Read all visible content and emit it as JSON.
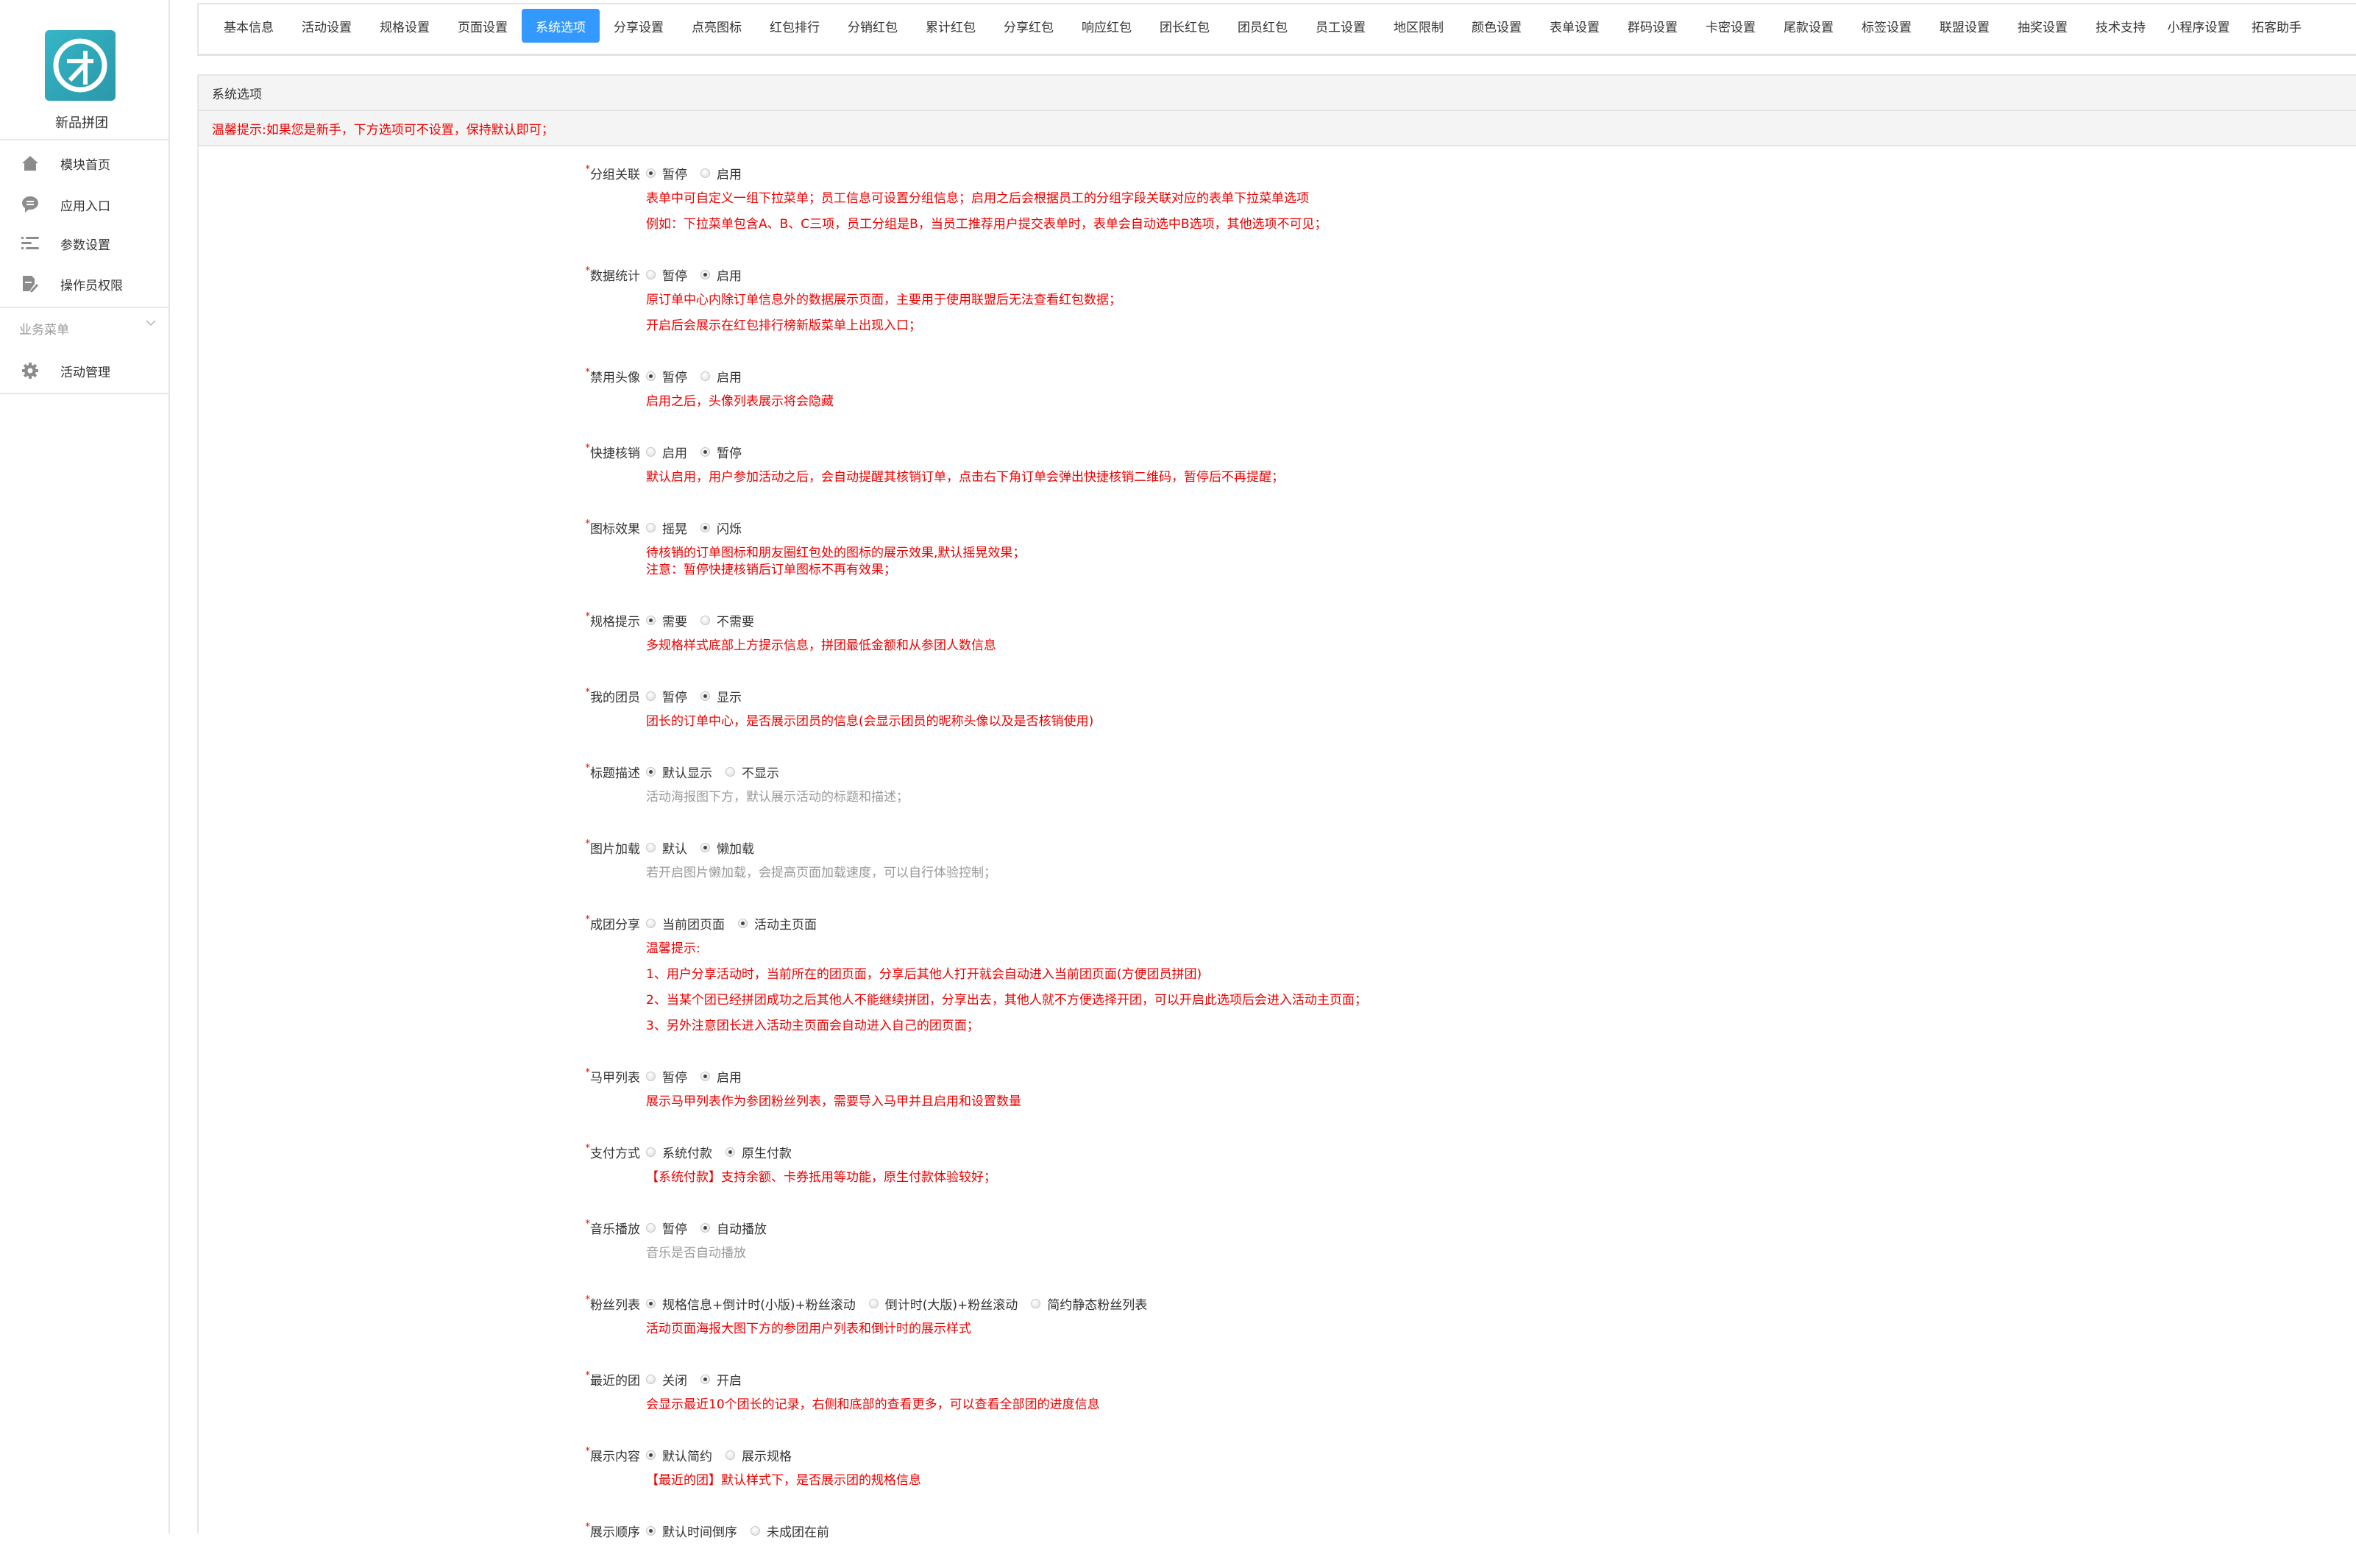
{
  "sidebar": {
    "app_name": "新品拼团",
    "logo_text": "才",
    "items": [
      {
        "label": "模块首页",
        "icon": "home-icon"
      },
      {
        "label": "应用入口",
        "icon": "chat-bubble-icon"
      },
      {
        "label": "参数设置",
        "icon": "list-icon"
      },
      {
        "label": "操作员权限",
        "icon": "document-edit-icon"
      }
    ],
    "group_title": "业务菜单",
    "group_items": [
      {
        "label": "活动管理",
        "icon": "gear-icon"
      }
    ]
  },
  "tabs": {
    "active_index": 4,
    "items": [
      "基本信息",
      "活动设置",
      "规格设置",
      "页面设置",
      "系统选项",
      "分享设置",
      "点亮图标",
      "红包排行",
      "分销红包",
      "累计红包",
      "分享红包",
      "响应红包",
      "团长红包",
      "团员红包",
      "员工设置",
      "地区限制",
      "颜色设置",
      "表单设置",
      "群码设置",
      "卡密设置",
      "尾款设置",
      "标签设置",
      "联盟设置",
      "抽奖设置",
      "技术支持",
      "小程序设置",
      "拓客助手"
    ]
  },
  "panel": {
    "title": "系统选项",
    "warning": "温馨提示:如果您是新手，下方选项可不设置，保持默认即可；"
  },
  "colors": {
    "accent": "#3399ff",
    "help_red": "#ee0000",
    "help_gray": "#999999"
  },
  "settings": [
    {
      "label": "分组关联",
      "options": [
        "暂停",
        "启用"
      ],
      "selected": 0,
      "help_color": "red",
      "help": [
        "表单中可自定义一组下拉菜单；员工信息可设置分组信息；启用之后会根据员工的分组字段关联对应的表单下拉菜单选项",
        "例如：下拉菜单包含A、B、C三项，员工分组是B，当员工推荐用户提交表单时，表单会自动选中B选项，其他选项不可见；"
      ]
    },
    {
      "label": "数据统计",
      "options": [
        "暂停",
        "启用"
      ],
      "selected": 1,
      "help_color": "red",
      "help": [
        "原订单中心内除订单信息外的数据展示页面，主要用于使用联盟后无法查看红包数据；",
        "开启后会展示在红包排行榜新版菜单上出现入口；"
      ]
    },
    {
      "label": "禁用头像",
      "options": [
        "暂停",
        "启用"
      ],
      "selected": 0,
      "help_color": "red",
      "help": [
        "启用之后，头像列表展示将会隐藏"
      ]
    },
    {
      "label": "快捷核销",
      "options": [
        "启用",
        "暂停"
      ],
      "selected": 1,
      "help_color": "red",
      "help": [
        "默认启用，用户参加活动之后，会自动提醒其核销订单，点击右下角订单会弹出快捷核销二维码，暂停后不再提醒；"
      ]
    },
    {
      "label": "图标效果",
      "options": [
        "摇晃",
        "闪烁"
      ],
      "selected": 1,
      "help_color": "red",
      "compact": true,
      "help": [
        "待核销的订单图标和朋友圈红包处的图标的展示效果,默认摇晃效果；",
        "注意：暂停快捷核销后订单图标不再有效果；"
      ]
    },
    {
      "label": "规格提示",
      "options": [
        "需要",
        "不需要"
      ],
      "selected": 0,
      "help_color": "red",
      "help": [
        "多规格样式底部上方提示信息，拼团最低金额和从参团人数信息"
      ]
    },
    {
      "label": "我的团员",
      "options": [
        "暂停",
        "显示"
      ],
      "selected": 1,
      "help_color": "red",
      "help": [
        "团长的订单中心，是否展示团员的信息(会显示团员的昵称头像以及是否核销使用)"
      ]
    },
    {
      "label": "标题描述",
      "options": [
        "默认显示",
        "不显示"
      ],
      "selected": 0,
      "help_color": "gray",
      "help": [
        "活动海报图下方，默认展示活动的标题和描述；"
      ]
    },
    {
      "label": "图片加载",
      "options": [
        "默认",
        "懒加载"
      ],
      "selected": 1,
      "help_color": "gray",
      "help": [
        "若开启图片懒加载，会提高页面加载速度，可以自行体验控制；"
      ]
    },
    {
      "label": "成团分享",
      "options": [
        "当前团页面",
        "活动主页面"
      ],
      "selected": 1,
      "help_color": "red",
      "help": [
        "温馨提示:",
        "1、用户分享活动时，当前所在的团页面，分享后其他人打开就会自动进入当前团页面(方便团员拼团)",
        "2、当某个团已经拼团成功之后其他人不能继续拼团，分享出去，其他人就不方便选择开团，可以开启此选项后会进入活动主页面；",
        "3、另外注意团长进入活动主页面会自动进入自己的团页面；"
      ]
    },
    {
      "label": "马甲列表",
      "options": [
        "暂停",
        "启用"
      ],
      "selected": 1,
      "help_color": "red",
      "help": [
        "展示马甲列表作为参团粉丝列表，需要导入马甲并且启用和设置数量"
      ]
    },
    {
      "label": "支付方式",
      "options": [
        "系统付款",
        "原生付款"
      ],
      "selected": 1,
      "help_color": "red",
      "help": [
        "【系统付款】支持余额、卡券抵用等功能，原生付款体验较好；"
      ]
    },
    {
      "label": "音乐播放",
      "options": [
        "暂停",
        "自动播放"
      ],
      "selected": 1,
      "help_color": "gray",
      "help": [
        "音乐是否自动播放"
      ]
    },
    {
      "label": "粉丝列表",
      "options": [
        "规格信息+倒计时(小版)+粉丝滚动",
        "倒计时(大版)+粉丝滚动",
        "简约静态粉丝列表"
      ],
      "selected": 0,
      "help_color": "red",
      "help": [
        "活动页面海报大图下方的参团用户列表和倒计时的展示样式"
      ]
    },
    {
      "label": "最近的团",
      "options": [
        "关闭",
        "开启"
      ],
      "selected": 1,
      "help_color": "red",
      "help": [
        "会显示最近10个团长的记录，右侧和底部的查看更多，可以查看全部团的进度信息"
      ]
    },
    {
      "label": "展示内容",
      "options": [
        "默认简约",
        "展示规格"
      ],
      "selected": 0,
      "help_color": "red",
      "help": [
        "【最近的团】默认样式下，是否展示团的规格信息"
      ]
    },
    {
      "label": "展示顺序",
      "options": [
        "默认时间倒序",
        "未成团在前"
      ],
      "selected": 0,
      "help_color": "red",
      "help": []
    }
  ]
}
